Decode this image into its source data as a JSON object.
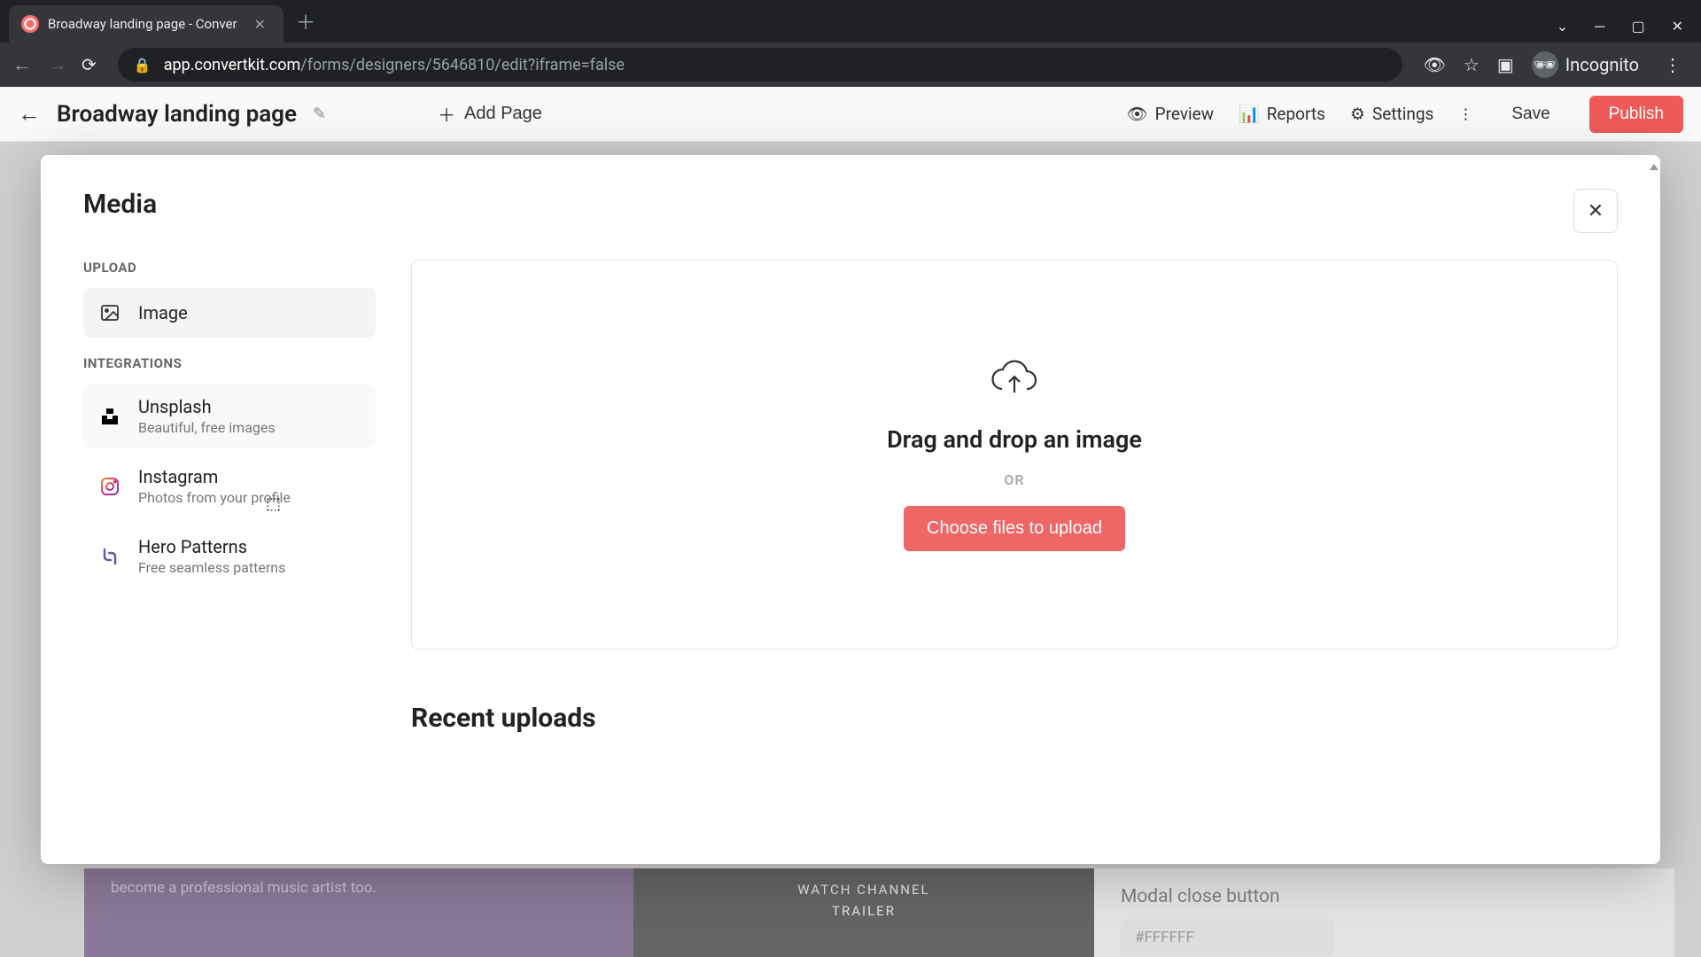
{
  "browser": {
    "tab_title": "Broadway landing page - Conver",
    "url_domain": "app.convertkit.com",
    "url_path": "/forms/designers/5646810/edit?iframe=false",
    "incognito_label": "Incognito"
  },
  "header": {
    "page_title": "Broadway landing page",
    "add_page": "Add Page",
    "preview": "Preview",
    "reports": "Reports",
    "settings": "Settings",
    "save": "Save",
    "publish": "Publish"
  },
  "modal": {
    "title": "Media",
    "upload_label": "UPLOAD",
    "integrations_label": "INTEGRATIONS",
    "items": {
      "image": {
        "title": "Image"
      },
      "unsplash": {
        "title": "Unsplash",
        "desc": "Beautiful, free images"
      },
      "instagram": {
        "title": "Instagram",
        "desc": "Photos from your profile"
      },
      "hero_patterns": {
        "title": "Hero Patterns",
        "desc": "Free seamless patterns"
      }
    },
    "dropzone": {
      "text": "Drag and drop an image",
      "or": "OR",
      "button": "Choose files to upload"
    },
    "recent_heading": "Recent uploads"
  },
  "background": {
    "purple_text": "become a professional music artist too.",
    "trailer_line1": "WATCH CHANNEL",
    "trailer_line2": "TRAILER",
    "right_label": "Modal close button",
    "right_color": "#FFFFFF"
  }
}
